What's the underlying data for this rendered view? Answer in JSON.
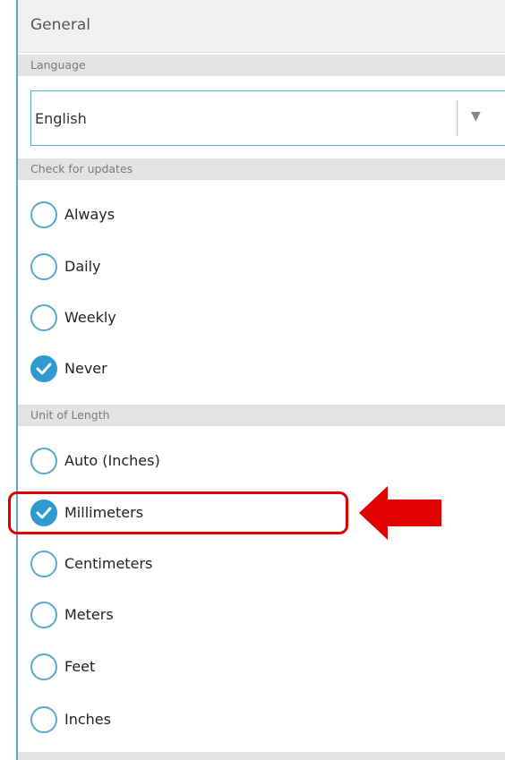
{
  "panel": {
    "title": "General"
  },
  "language": {
    "section_label": "Language",
    "selected": "English",
    "arrow_glyph": "▼"
  },
  "updates": {
    "section_label": "Check for updates",
    "options": [
      {
        "label": "Always",
        "checked": false
      },
      {
        "label": "Daily",
        "checked": false
      },
      {
        "label": "Weekly",
        "checked": false
      },
      {
        "label": "Never",
        "checked": true
      }
    ]
  },
  "units": {
    "section_label": "Unit of Length",
    "options": [
      {
        "label": "Auto (Inches)",
        "checked": false
      },
      {
        "label": "Millimeters",
        "checked": true
      },
      {
        "label": "Centimeters",
        "checked": false
      },
      {
        "label": "Meters",
        "checked": false
      },
      {
        "label": "Feet",
        "checked": false
      },
      {
        "label": "Inches",
        "checked": false
      }
    ]
  },
  "colors": {
    "accent": "#2f9ad1",
    "annotation": "#e00000"
  },
  "annotation": {
    "target": "Millimeters",
    "icon": "left-arrow-icon"
  }
}
